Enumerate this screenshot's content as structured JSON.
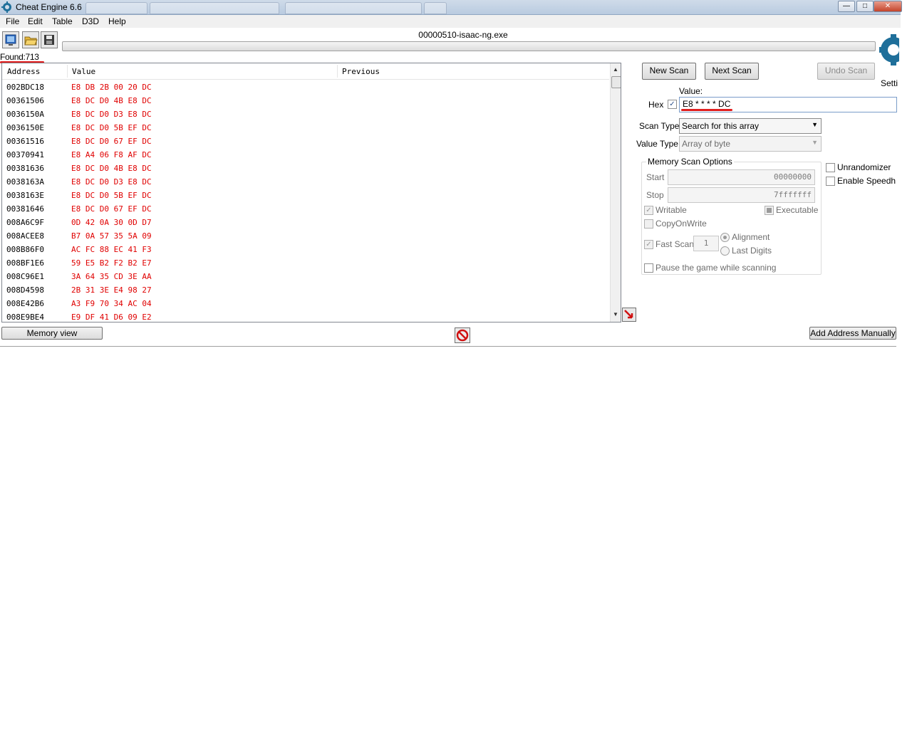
{
  "window": {
    "title": "Cheat Engine 6.6",
    "caption_buttons": {
      "minimize": "—",
      "maximize": "□",
      "close": "✕"
    }
  },
  "menu": [
    "File",
    "Edit",
    "Table",
    "D3D",
    "Help"
  ],
  "toolbar": {
    "process_title": "00000510-isaac-ng.exe",
    "icons": [
      "select-process-icon",
      "open-file-icon",
      "save-icon"
    ]
  },
  "found_label": "Found:713",
  "results": {
    "columns": [
      "Address",
      "Value",
      "Previous"
    ],
    "rows": [
      {
        "address": "002BDC18",
        "value": "E8 DB 2B 00 20 DC"
      },
      {
        "address": "00361506",
        "value": "E8 DC D0 4B E8 DC"
      },
      {
        "address": "0036150A",
        "value": "E8 DC D0 D3 E8 DC"
      },
      {
        "address": "0036150E",
        "value": "E8 DC D0 5B EF DC"
      },
      {
        "address": "00361516",
        "value": "E8 DC D0 67 EF DC"
      },
      {
        "address": "00370941",
        "value": "E8 A4 06 F8 AF DC"
      },
      {
        "address": "00381636",
        "value": "E8 DC D0 4B E8 DC"
      },
      {
        "address": "0038163A",
        "value": "E8 DC D0 D3 E8 DC"
      },
      {
        "address": "0038163E",
        "value": "E8 DC D0 5B EF DC"
      },
      {
        "address": "00381646",
        "value": "E8 DC D0 67 EF DC"
      },
      {
        "address": "008A6C9F",
        "value": "0D 42 0A 30 0D D7"
      },
      {
        "address": "008ACEE8",
        "value": "B7 0A 57 35 5A 09"
      },
      {
        "address": "008B86F0",
        "value": "AC FC 88 EC 41 F3"
      },
      {
        "address": "008BF1E6",
        "value": "59 E5 B2 F2 B2 E7"
      },
      {
        "address": "008C96E1",
        "value": "3A 64 35 CD 3E AA"
      },
      {
        "address": "008D4598",
        "value": "2B 31 3E E4 98 27"
      },
      {
        "address": "008E42B6",
        "value": "A3 F9 70 34 AC 04"
      },
      {
        "address": "008E9BE4",
        "value": "E9 DF 41 D6 09 E2"
      }
    ]
  },
  "buttons": {
    "new_scan": "New Scan",
    "next_scan": "Next Scan",
    "undo_scan": "Undo Scan",
    "memory_view": "Memory view",
    "add_address": "Add Address Manually"
  },
  "settings_label": "Settings",
  "value_section": {
    "label": "Value:",
    "hex_label": "Hex",
    "hex_checked": true,
    "value": "E8 * * * * DC"
  },
  "scan_type": {
    "label": "Scan Type",
    "selected": "Search for this array"
  },
  "value_type": {
    "label": "Value Type",
    "selected": "Array of byte"
  },
  "memory_options": {
    "title": "Memory Scan Options",
    "start_label": "Start",
    "start_value": "00000000",
    "stop_label": "Stop",
    "stop_value": "7fffffff",
    "writable": "Writable",
    "executable": "Executable",
    "copy_on_write": "CopyOnWrite",
    "fast_scan": "Fast Scan",
    "fast_scan_value": "1",
    "alignment": "Alignment",
    "last_digits": "Last Digits",
    "pause": "Pause the game while scanning"
  },
  "side_options": {
    "unrandomizer": "Unrandomizer",
    "enable_speedhack": "Enable Speedhack"
  },
  "colors": {
    "value_red": "#e00000",
    "annotation_red": "#e01e1e"
  }
}
